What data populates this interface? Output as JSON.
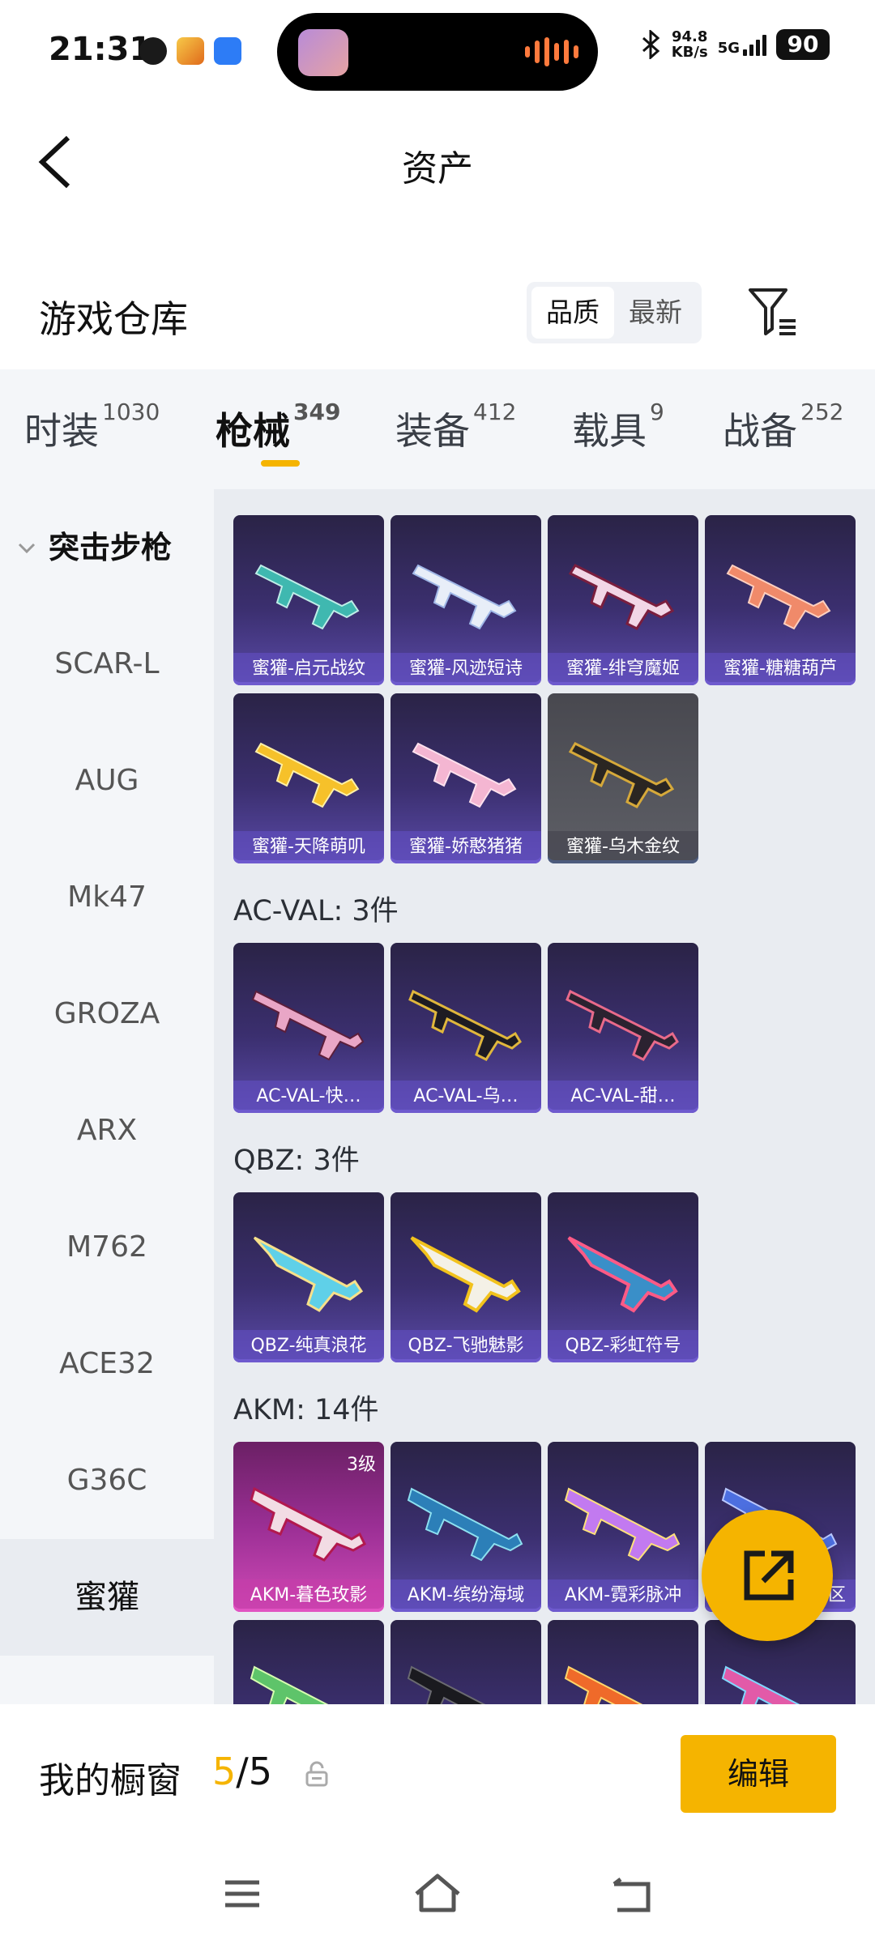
{
  "status_bar": {
    "time": "21:31",
    "net_speed": "94.8",
    "net_unit": "KB/s",
    "network": "5G",
    "battery": "90"
  },
  "header": {
    "title": "资产"
  },
  "section": {
    "title": "游戏仓库",
    "sort_options": [
      "品质",
      "最新"
    ]
  },
  "tabs": [
    {
      "label": "时装",
      "count": "1030"
    },
    {
      "label": "枪械",
      "count": "349"
    },
    {
      "label": "装备",
      "count": "412"
    },
    {
      "label": "载具",
      "count": "9"
    },
    {
      "label": "战备",
      "count": "252"
    }
  ],
  "sidenav": {
    "group": "突击步枪",
    "items": [
      "SCAR-L",
      "AUG",
      "Mk47",
      "GROZA",
      "ARX",
      "M762",
      "ACE32",
      "G36C",
      "蜜獾"
    ]
  },
  "groups": [
    {
      "title": "",
      "items": [
        "蜜獾-启元战纹",
        "蜜獾-风迹短诗",
        "蜜獾-绯穹魔姬",
        "蜜獾-糖糖葫芦",
        "蜜獾-天降萌叽",
        "蜜獾-娇憨猪猪",
        "蜜獾-乌木金纹"
      ]
    },
    {
      "title": "AC-VAL: 3件",
      "items": [
        "AC-VAL-快…",
        "AC-VAL-乌…",
        "AC-VAL-甜…"
      ]
    },
    {
      "title": "QBZ: 3件",
      "items": [
        "QBZ-纯真浪花",
        "QBZ-飞驰魅影",
        "QBZ-彩虹符号"
      ]
    },
    {
      "title": "AKM: 14件",
      "items": [
        "AKM-暮色玫影",
        "AKM-缤纷海域",
        "AKM-霓彩脉冲",
        "区"
      ],
      "first_level": "3级"
    }
  ],
  "showcase": {
    "label": "我的橱窗",
    "current": "5",
    "total": "/5"
  },
  "edit_button": "编辑",
  "colors": {
    "accent": "#f5b400",
    "card": "#3b2f6f",
    "background": "#e9ecf1"
  }
}
